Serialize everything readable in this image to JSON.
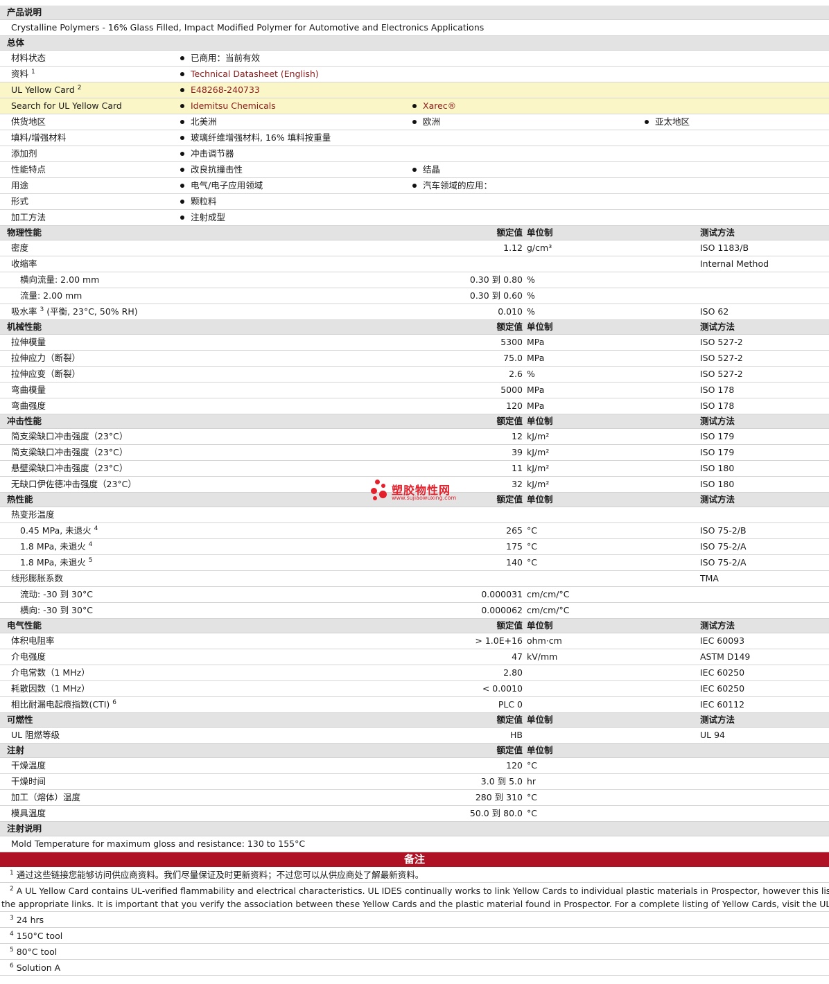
{
  "product_description": {
    "title": "产品说明",
    "text": "Crystalline Polymers - 16% Glass Filled, Impact Modified Polymer for Automotive and Electronics Applications"
  },
  "general": {
    "title": "总体",
    "rows": {
      "status": {
        "label": "材料状态",
        "v1": "已商用：当前有效"
      },
      "datasheet": {
        "label": "资料",
        "sup": "1",
        "v1": "Technical Datasheet (English)"
      },
      "ulcard": {
        "label": "UL Yellow Card",
        "sup": "2",
        "v1": "E48268-240733"
      },
      "search": {
        "label": "Search for UL Yellow Card",
        "v1": "Idemitsu Chemicals",
        "v2": "Xarec®"
      },
      "region": {
        "label": "供货地区",
        "v1": "北美洲",
        "v2": "欧洲",
        "v3": "亚太地区"
      },
      "filler": {
        "label": "填料/增强材料",
        "v1": "玻璃纤维增强材料, 16% 填料按重量"
      },
      "additive": {
        "label": "添加剂",
        "v1": "冲击调节器"
      },
      "features": {
        "label": "性能特点",
        "v1": "改良抗撞击性",
        "v2": "结晶"
      },
      "uses": {
        "label": "用途",
        "v1": "电气/电子应用领域",
        "v2": "汽车领域的应用："
      },
      "form": {
        "label": "形式",
        "v1": "颗粒料"
      },
      "processing": {
        "label": "加工方法",
        "v1": "注射成型"
      }
    }
  },
  "headers": {
    "value": "额定值",
    "unit": "单位制",
    "method": "测试方法"
  },
  "physical": {
    "title": "物理性能",
    "density": {
      "label": "密度",
      "value": "1.12",
      "unit": "g/cm³",
      "method": "ISO 1183/B"
    },
    "shrink": {
      "label": "收缩率",
      "method": "Internal Method"
    },
    "shrink_cross": {
      "label": "横向流量: 2.00 mm",
      "value": "0.30 到  0.80",
      "unit": "%"
    },
    "shrink_flow": {
      "label": "流量: 2.00 mm",
      "value": "0.30 到  0.60",
      "unit": "%"
    },
    "water": {
      "label": "吸水率",
      "sup": "3",
      "label2": "(平衡, 23°C, 50% RH)",
      "value": "0.010",
      "unit": "%",
      "method": "ISO 62"
    }
  },
  "mechanical": {
    "title": "机械性能",
    "rows": [
      {
        "label": "拉伸模量",
        "value": "5300",
        "unit": "MPa",
        "method": "ISO 527-2"
      },
      {
        "label": "拉伸应力（断裂）",
        "value": "75.0",
        "unit": "MPa",
        "method": "ISO 527-2"
      },
      {
        "label": "拉伸应变（断裂）",
        "value": "2.6",
        "unit": "%",
        "method": "ISO 527-2"
      },
      {
        "label": "弯曲模量",
        "value": "5000",
        "unit": "MPa",
        "method": "ISO 178"
      },
      {
        "label": "弯曲强度",
        "value": "120",
        "unit": "MPa",
        "method": "ISO 178"
      }
    ]
  },
  "impact": {
    "title": "冲击性能",
    "rows": [
      {
        "label": "简支梁缺口冲击强度（23°C）",
        "value": "12",
        "unit": "kJ/m²",
        "method": "ISO 179"
      },
      {
        "label": "简支梁缺口冲击强度（23°C）",
        "value": "39",
        "unit": "kJ/m²",
        "method": "ISO 179"
      },
      {
        "label": "悬壁梁缺口冲击强度（23°C）",
        "value": "11",
        "unit": "kJ/m²",
        "method": "ISO 180"
      },
      {
        "label": "无缺口伊佐德冲击强度（23°C）",
        "value": "32",
        "unit": "kJ/m²",
        "method": "ISO 180"
      }
    ]
  },
  "thermal": {
    "title": "热性能",
    "hdt": {
      "label": "热变形温度"
    },
    "hdt1": {
      "label": "0.45 MPa, 未退火",
      "sup": "4",
      "value": "265",
      "unit": "°C",
      "method": "ISO 75-2/B"
    },
    "hdt2": {
      "label": "1.8 MPa, 未退火",
      "sup": "4",
      "value": "175",
      "unit": "°C",
      "method": "ISO 75-2/A"
    },
    "hdt3": {
      "label": "1.8 MPa, 未退火",
      "sup": "5",
      "value": "140",
      "unit": "°C",
      "method": "ISO 75-2/A"
    },
    "clte": {
      "label": "线形膨胀系数",
      "method": "TMA"
    },
    "clte_flow": {
      "label": "流动: -30 到  30°C",
      "value": "0.000031",
      "unit": "cm/cm/°C"
    },
    "clte_cross": {
      "label": "横向: -30 到  30°C",
      "value": "0.000062",
      "unit": "cm/cm/°C"
    }
  },
  "electrical": {
    "title": "电气性能",
    "rows": [
      {
        "label": "体积电阻率",
        "value": "> 1.0E+16",
        "unit": "ohm·cm",
        "method": "IEC 60093"
      },
      {
        "label": "介电强度",
        "value": "47",
        "unit": "kV/mm",
        "method": "ASTM D149"
      },
      {
        "label": "介电常数（1 MHz）",
        "value": "2.80",
        "unit": "",
        "method": "IEC 60250"
      },
      {
        "label": "耗散因数（1 MHz）",
        "value": "< 0.0010",
        "unit": "",
        "method": "IEC 60250"
      }
    ],
    "cti": {
      "label": "相比耐漏电起痕指数(CTI)",
      "sup": "6",
      "value": "PLC 0",
      "method": "IEC 60112"
    }
  },
  "flammability": {
    "title": "可燃性",
    "rows": [
      {
        "label": "UL 阻燃等级",
        "value": "HB",
        "unit": "",
        "method": "UL 94"
      }
    ]
  },
  "injection": {
    "title": "注射",
    "rows": [
      {
        "label": "干燥温度",
        "value": "120",
        "unit": "°C"
      },
      {
        "label": "干燥时间",
        "value": "3.0 到  5.0",
        "unit": "hr"
      },
      {
        "label": "加工（熔体）温度",
        "value": "280 到  310",
        "unit": "°C"
      },
      {
        "label": "模具温度",
        "value": "50.0 到  80.0",
        "unit": "°C"
      }
    ]
  },
  "injection_notes": {
    "title": "注射说明",
    "text": "Mold Temperature for maximum gloss and resistance: 130 to 155°C"
  },
  "notes": {
    "title": "备注",
    "n1": {
      "num": "1",
      "text": "通过这些链接您能够访问供应商资料。我们尽量保证及时更新资料；不过您可以从供应商处了解最新资料。"
    },
    "n2": {
      "num": "2",
      "text": "A UL Yellow Card contains UL-verified flammability and electrical characteristics. UL IDES continually works to link Yellow Cards to individual plastic materials in Prospector, however this list may not inclu",
      "text2": "the appropriate links. It is important that you verify the association between these Yellow Cards and the plastic material found in Prospector. For a complete listing of Yellow Cards, visit the UL Yellow Card Se"
    },
    "n3": {
      "num": "3",
      "text": "24 hrs"
    },
    "n4": {
      "num": "4",
      "text": "150°C tool"
    },
    "n5": {
      "num": "5",
      "text": "80°C tool"
    },
    "n6": {
      "num": "6",
      "text": "Solution A"
    }
  },
  "watermark": {
    "name": "塑胶物性网",
    "url": "www.sujiaowuxing.com",
    "color": "#e3202b"
  }
}
